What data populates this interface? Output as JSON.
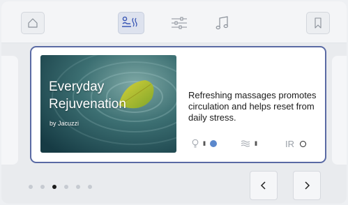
{
  "topbar": {
    "home_icon": "home-icon",
    "tabs": [
      {
        "icon": "massage-icon",
        "active": true
      },
      {
        "icon": "settings-sliders-icon",
        "active": false
      },
      {
        "icon": "music-icon",
        "active": false
      }
    ],
    "bookmark_icon": "bookmark-icon"
  },
  "card": {
    "title_line1": "Everyday",
    "title_line2": "Rejuvenation",
    "subtitle": "by Jacuzzi",
    "description": "Refreshing massages promotes circulation and helps reset from daily stress.",
    "indicators": {
      "light": {
        "icon": "bulb-icon",
        "level": "II",
        "status": "on"
      },
      "jets": {
        "icon": "jets-icon",
        "level": "II"
      },
      "ir": {
        "label": "IR",
        "status": "off"
      }
    },
    "accent_color": "#5b88cc",
    "border_color": "#5a6aa4"
  },
  "pager": {
    "total": 6,
    "current": 3
  },
  "nav": {
    "prev_icon": "chevron-left-icon",
    "next_icon": "chevron-right-icon"
  }
}
